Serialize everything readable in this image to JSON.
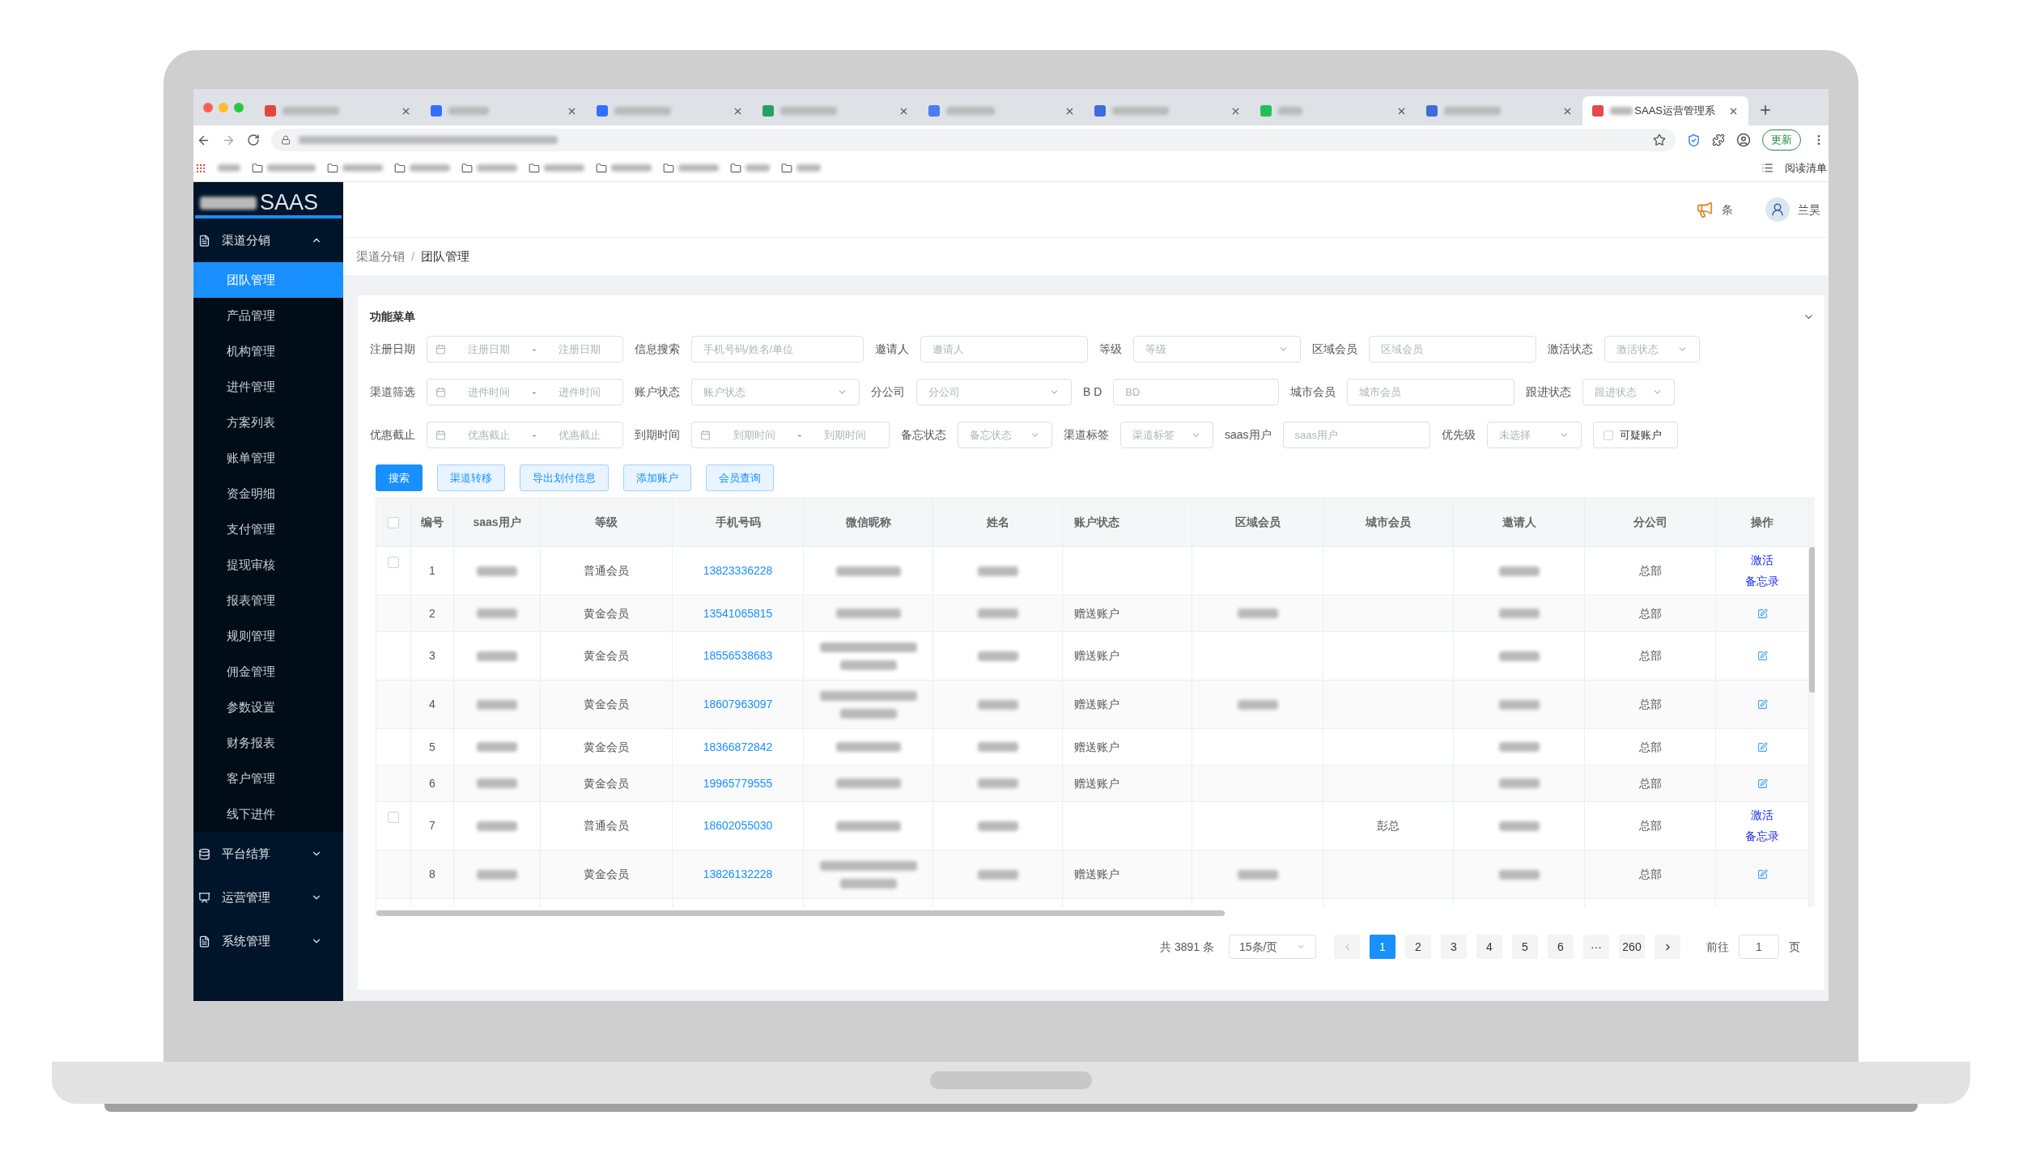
{
  "browser": {
    "tabs": [
      {
        "color": "#e0483e",
        "selected": false
      },
      {
        "color": "#3370ff",
        "selected": false
      },
      {
        "color": "#3370ff",
        "selected": false
      },
      {
        "color": "#21a366",
        "selected": false
      },
      {
        "color": "#4a7cf7",
        "selected": false
      },
      {
        "color": "#3d6be0",
        "selected": false
      },
      {
        "color": "#23c05a",
        "selected": false
      },
      {
        "color": "#3a6fd8",
        "selected": false
      },
      {
        "color": "#e5484d",
        "selected": true,
        "title": "SAAS运营管理系"
      }
    ],
    "update_button": "更新",
    "reading_list": "阅读清单"
  },
  "logo": "SAAS",
  "header": {
    "notice": "条",
    "user": "兰昊"
  },
  "sidebar": [
    {
      "label": "渠道分销",
      "expanded": true,
      "children": [
        {
          "label": "团队管理",
          "selected": true
        },
        {
          "label": "产品管理",
          "selected": false
        },
        {
          "label": "机构管理",
          "selected": false
        },
        {
          "label": "进件管理",
          "selected": false
        },
        {
          "label": "方案列表",
          "selected": false
        },
        {
          "label": "账单管理",
          "selected": false
        },
        {
          "label": "资金明细",
          "selected": false
        },
        {
          "label": "支付管理",
          "selected": false
        },
        {
          "label": "提现审核",
          "selected": false
        },
        {
          "label": "报表管理",
          "selected": false
        },
        {
          "label": "规则管理",
          "selected": false
        },
        {
          "label": "佣金管理",
          "selected": false
        },
        {
          "label": "参数设置",
          "selected": false
        },
        {
          "label": "财务报表",
          "selected": false
        },
        {
          "label": "客户管理",
          "selected": false
        },
        {
          "label": "线下进件",
          "selected": false
        }
      ]
    },
    {
      "label": "平台结算",
      "expanded": false
    },
    {
      "label": "运营管理",
      "expanded": false
    },
    {
      "label": "系统管理",
      "expanded": false
    }
  ],
  "breadcrumb": [
    "渠道分销",
    "团队管理"
  ],
  "breadcrumb_separator": "/",
  "filter_panel": {
    "title": "功能菜单",
    "expanded": true,
    "rows": [
      [
        {
          "kind": "daterange",
          "label": "注册日期",
          "placeholders": [
            "注册日期",
            "注册日期"
          ],
          "separator": "-"
        },
        {
          "kind": "input",
          "label": "信息搜索",
          "placeholder": "手机号码/姓名/单位"
        },
        {
          "kind": "input",
          "label": "邀请人",
          "placeholder": "邀请人"
        },
        {
          "kind": "select",
          "label": "等级",
          "placeholder": "等级"
        },
        {
          "kind": "input",
          "label": "区域会员",
          "placeholder": "区域会员"
        },
        {
          "kind": "select",
          "label": "激活状态",
          "placeholder": "激活状态"
        }
      ],
      [
        {
          "kind": "daterange",
          "label": "渠道筛选",
          "placeholders": [
            "进件时间",
            "进件时间"
          ],
          "separator": "-"
        },
        {
          "kind": "select",
          "label": "账户状态",
          "placeholder": "账户状态"
        },
        {
          "kind": "select",
          "label": "分公司",
          "placeholder": "分公司"
        },
        {
          "kind": "input",
          "label": "B D",
          "placeholder": "BD"
        },
        {
          "kind": "input",
          "label": "城市会员",
          "placeholder": "城市会员"
        },
        {
          "kind": "select",
          "label": "跟进状态",
          "placeholder": "跟进状态"
        }
      ],
      [
        {
          "kind": "daterange",
          "label": "优惠截止",
          "placeholders": [
            "优惠截止",
            "优惠截止"
          ],
          "separator": "-"
        },
        {
          "kind": "daterange",
          "label": "到期时间",
          "placeholders": [
            "到期时间",
            "到期时间"
          ],
          "separator": "-"
        },
        {
          "kind": "select",
          "label": "备忘状态",
          "placeholder": "备忘状态"
        },
        {
          "kind": "select",
          "label": "渠道标签",
          "placeholder": "渠道标签"
        },
        {
          "kind": "input",
          "label": "saas用户",
          "placeholder": "saas用户"
        },
        {
          "kind": "select",
          "label": "优先级",
          "placeholder": "未选择"
        },
        {
          "kind": "checkbox",
          "text": "可疑账户",
          "checked": false
        }
      ]
    ],
    "buttons": [
      {
        "label": "搜索",
        "kind": "primary"
      },
      {
        "label": "渠道转移",
        "kind": "plain"
      },
      {
        "label": "导出划付信息",
        "kind": "plain"
      },
      {
        "label": "添加账户",
        "kind": "plain"
      },
      {
        "label": "会员查询",
        "kind": "plain"
      }
    ]
  },
  "table": {
    "header_checked": false,
    "columns": [
      "编号",
      "saas用户",
      "等级",
      "手机号码",
      "微信昵称",
      "姓名",
      "账户状态",
      "区域会员",
      "城市会员",
      "邀请人",
      "分公司",
      "操作"
    ],
    "rows": [
      {
        "no": "1",
        "checked": false,
        "level": "普通会员",
        "phone": "13823336228",
        "branch": "总部",
        "actions": [
          "激活",
          "备忘录"
        ],
        "redacted": {
          "saas_user": true,
          "wechat": true,
          "name": true,
          "inviter": true
        },
        "tall": false
      },
      {
        "no": "2",
        "level": "黄金会员",
        "phone": "13541065815",
        "status": "赠送账户",
        "branch": "总部",
        "redacted": {
          "saas_user": true,
          "wechat": true,
          "name": true,
          "region": true,
          "inviter": true
        },
        "tall": false
      },
      {
        "no": "3",
        "level": "黄金会员",
        "phone": "18556538683",
        "status": "赠送账户",
        "branch": "总部",
        "redacted": {
          "saas_user": true,
          "wechat": true,
          "name": true,
          "inviter": true
        },
        "tall": true
      },
      {
        "no": "4",
        "level": "黄金会员",
        "phone": "18607963097",
        "status": "赠送账户",
        "branch": "总部",
        "redacted": {
          "saas_user": true,
          "wechat": true,
          "name": true,
          "region": true,
          "inviter": true
        },
        "tall": true
      },
      {
        "no": "5",
        "level": "黄金会员",
        "phone": "18366872842",
        "status": "赠送账户",
        "branch": "总部",
        "redacted": {
          "saas_user": true,
          "wechat": true,
          "name": true,
          "inviter": true
        },
        "tall": false
      },
      {
        "no": "6",
        "level": "黄金会员",
        "phone": "19965779555",
        "status": "赠送账户",
        "branch": "总部",
        "redacted": {
          "saas_user": true,
          "wechat": true,
          "name": true,
          "inviter": true
        },
        "tall": false
      },
      {
        "no": "7",
        "checked": false,
        "level": "普通会员",
        "phone": "18602055030",
        "city": "彭总",
        "branch": "总部",
        "actions": [
          "激活",
          "备忘录"
        ],
        "redacted": {
          "saas_user": true,
          "wechat": true,
          "name": true,
          "inviter": true
        },
        "tall": false
      },
      {
        "no": "8",
        "level": "黄金会员",
        "phone": "13826132228",
        "status": "赠送账户",
        "branch": "总部",
        "redacted": {
          "saas_user": true,
          "wechat": true,
          "name": true,
          "region": true,
          "inviter": true
        },
        "tall": true
      }
    ]
  },
  "pagination": {
    "total": "共 3891 条",
    "page_size": "15条/页",
    "prev_disabled": true,
    "pages": [
      {
        "label": "1",
        "selected": true
      },
      {
        "label": "2",
        "selected": false
      },
      {
        "label": "3",
        "selected": false
      },
      {
        "label": "4",
        "selected": false
      },
      {
        "label": "5",
        "selected": false
      },
      {
        "label": "6",
        "selected": false
      },
      {
        "label": "···",
        "selected": false
      },
      {
        "label": "260",
        "selected": false
      }
    ],
    "goto_label": "前往",
    "goto_value": "1",
    "goto_suffix": "页"
  }
}
